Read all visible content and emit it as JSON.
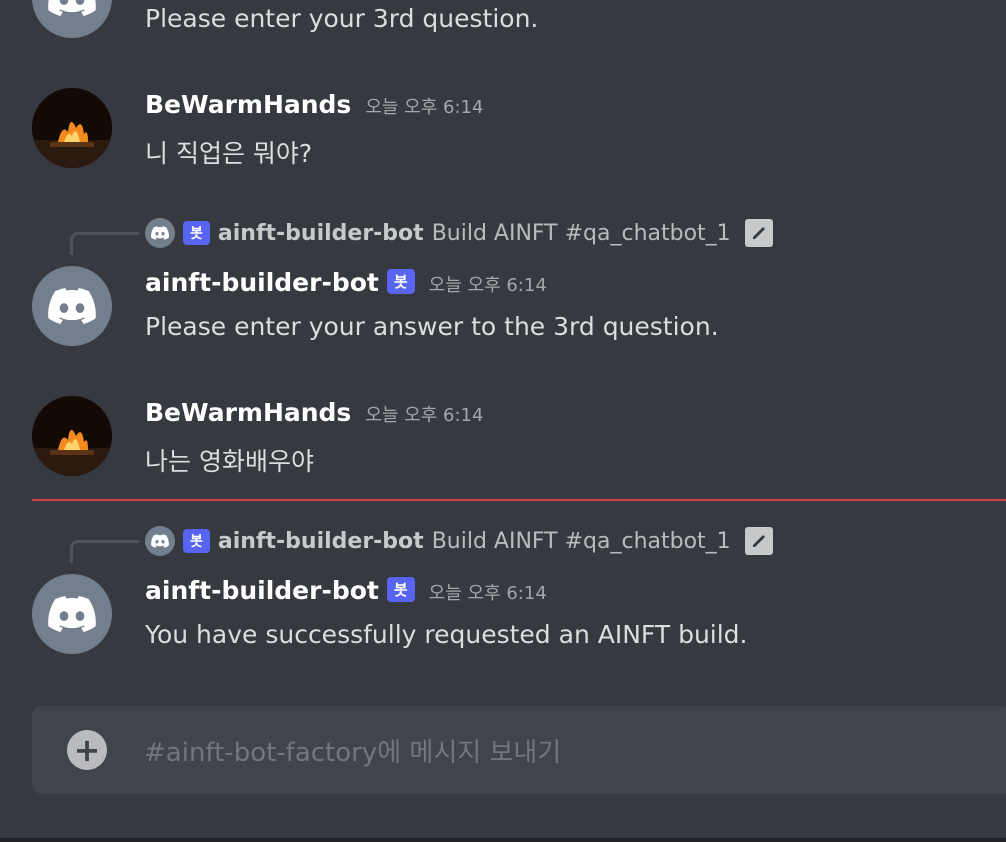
{
  "messages": [
    {
      "kind": "partial",
      "text": "Please enter your 3rd question."
    },
    {
      "kind": "user",
      "author": "BeWarmHands",
      "time": "오늘 오후 6:14",
      "text": "니 직업은 뭐야?"
    },
    {
      "kind": "bot",
      "reply": {
        "tag": "봇",
        "author": "ainft-builder-bot",
        "text": "Build AINFT #qa_chatbot_1"
      },
      "author": "ainft-builder-bot",
      "tag": "봇",
      "time": "오늘 오후 6:14",
      "text": "Please enter your answer to the 3rd question."
    },
    {
      "kind": "user",
      "author": "BeWarmHands",
      "time": "오늘 오후 6:14",
      "text": "나는 영화배우야"
    },
    {
      "kind": "bot",
      "reply": {
        "tag": "봇",
        "author": "ainft-builder-bot",
        "text": "Build AINFT #qa_chatbot_1"
      },
      "author": "ainft-builder-bot",
      "tag": "봇",
      "time": "오늘 오후 6:14",
      "text": "You have successfully requested an AINFT build."
    }
  ],
  "composer": {
    "placeholder": "#ainft-bot-factory에 메시지 보내기"
  },
  "colors": {
    "background": "#36393f",
    "bot_tag": "#5865f2",
    "new_divider": "#ed4245"
  }
}
